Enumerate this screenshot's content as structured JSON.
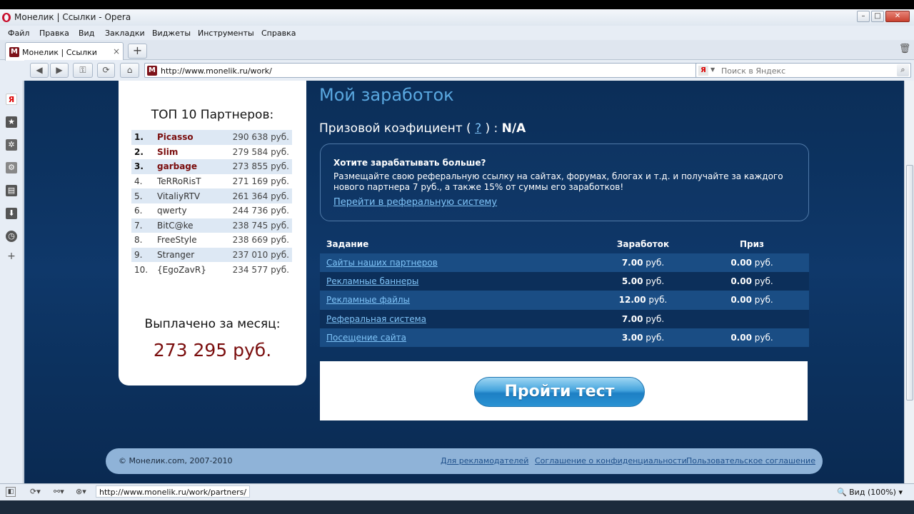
{
  "window": {
    "title": "Монелик | Ссылки - Opera"
  },
  "menu": [
    "Файл",
    "Правка",
    "Вид",
    "Закладки",
    "Виджеты",
    "Инструменты",
    "Справка"
  ],
  "tab": {
    "favicon": "М",
    "label": "Монелик | Ссылки",
    "close": "×"
  },
  "address": {
    "url": "http://www.monelik.ru/work/"
  },
  "search": {
    "placeholder": "Поиск в Яндекс",
    "engine_badge": "Я"
  },
  "partners": {
    "title": "ТОП 10 Партнеров:",
    "rows": [
      {
        "rank": "1.",
        "name": "Picasso",
        "amount": "290 638 руб."
      },
      {
        "rank": "2.",
        "name": "Slim",
        "amount": "279 584 руб."
      },
      {
        "rank": "3.",
        "name": "garbage",
        "amount": "273 855 руб."
      },
      {
        "rank": "4.",
        "name": "TeRRoRisT",
        "amount": "271 169 руб."
      },
      {
        "rank": "5.",
        "name": "VitaliyRTV",
        "amount": "261 364 руб."
      },
      {
        "rank": "6.",
        "name": "qwerty",
        "amount": "244 736 руб."
      },
      {
        "rank": "7.",
        "name": "BitC@ke",
        "amount": "238 745 руб."
      },
      {
        "rank": "8.",
        "name": "FreeStyle",
        "amount": "238 669 руб."
      },
      {
        "rank": "9.",
        "name": "Stranger",
        "amount": "237 010 руб."
      },
      {
        "rank": "10.",
        "name": "{EgoZavR}",
        "amount": "234 577 руб."
      }
    ],
    "paid_label": "Выплачено за месяц:",
    "paid_total": "273 295 руб."
  },
  "main": {
    "heading": "Мой заработок",
    "coef_label": "Призовой коэфициент (",
    "coef_q": "?",
    "coef_mid": ") :",
    "coef_value": "N/A",
    "promo": {
      "title": "Хотите зарабатывать больше?",
      "text": "Размещайте свою реферальную ссылку на сайтах, форумах, блогах и т.д. и получайте за каждого нового партнера 7 руб., а также 15% от суммы его заработков!",
      "link": "Перейти в реферальную систему"
    },
    "table": {
      "headers": [
        "Задание",
        "Заработок",
        "Приз"
      ],
      "rows": [
        {
          "task": "Сайты наших партнеров",
          "earn": "7.00",
          "prize": "0.00"
        },
        {
          "task": "Рекламные баннеры",
          "earn": "5.00",
          "prize": "0.00"
        },
        {
          "task": "Рекламные файлы",
          "earn": "12.00",
          "prize": "0.00"
        },
        {
          "task": "Реферальная система",
          "earn": "7.00",
          "prize": ""
        },
        {
          "task": "Посещение сайта",
          "earn": "3.00",
          "prize": "0.00"
        }
      ],
      "currency": "руб."
    },
    "test_button": "Пройти тест"
  },
  "footer": {
    "copyright": "© Монелик.com, 2007-2010",
    "links": [
      "Для рекламодателей",
      "Соглашение о конфиденциальности",
      "Пользовательское соглашение"
    ]
  },
  "status": {
    "url": "http://www.monelik.ru/work/partners/",
    "zoom": "Вид (100%)"
  },
  "colors": {
    "page_bg": "#0d3463",
    "accent_link": "#7fc3f7",
    "heading": "#5aa8e0",
    "leader_name": "#7a0d0d"
  }
}
